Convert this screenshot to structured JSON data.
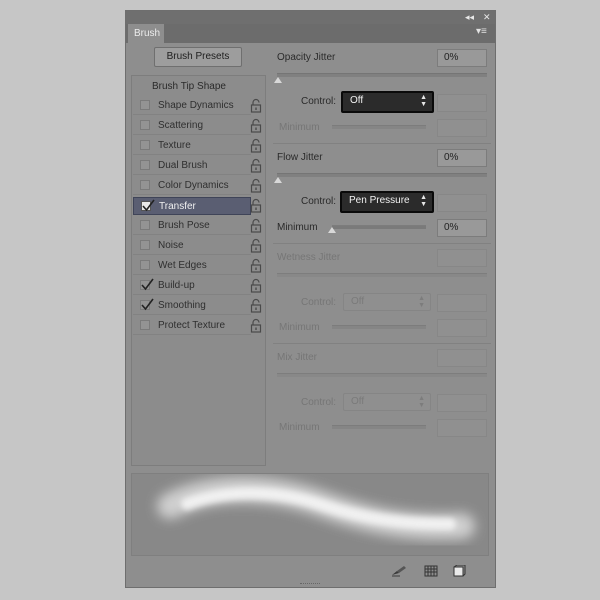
{
  "panel": {
    "title": "Brush",
    "collapse_glyph": "◂◂",
    "close_glyph": "✕",
    "menu_glyph": "▾≡"
  },
  "presets_button": "Brush Presets",
  "sidebar": {
    "header": "Brush Tip Shape",
    "items": [
      {
        "label": "Shape Dynamics",
        "checked": false,
        "selected": false
      },
      {
        "label": "Scattering",
        "checked": false,
        "selected": false
      },
      {
        "label": "Texture",
        "checked": false,
        "selected": false
      },
      {
        "label": "Dual Brush",
        "checked": false,
        "selected": false
      },
      {
        "label": "Color Dynamics",
        "checked": false,
        "selected": false
      },
      {
        "label": "Transfer",
        "checked": true,
        "selected": true
      },
      {
        "label": "Brush Pose",
        "checked": false,
        "selected": false
      },
      {
        "label": "Noise",
        "checked": false,
        "selected": false
      },
      {
        "label": "Wet Edges",
        "checked": false,
        "selected": false
      },
      {
        "label": "Build-up",
        "checked": true,
        "selected": false
      },
      {
        "label": "Smoothing",
        "checked": true,
        "selected": false
      },
      {
        "label": "Protect Texture",
        "checked": false,
        "selected": false
      }
    ]
  },
  "settings": {
    "opacity_jitter": {
      "label": "Opacity Jitter",
      "value": "0%",
      "control_label": "Control:",
      "control_value": "Off",
      "minimum_label": "Minimum"
    },
    "flow_jitter": {
      "label": "Flow Jitter",
      "value": "0%",
      "control_label": "Control:",
      "control_value": "Pen Pressure",
      "minimum_label": "Minimum",
      "minimum_value": "0%"
    },
    "wetness_jitter": {
      "label": "Wetness Jitter",
      "control_label": "Control:",
      "control_value": "Off",
      "minimum_label": "Minimum"
    },
    "mix_jitter": {
      "label": "Mix Jitter",
      "control_label": "Control:",
      "control_value": "Off",
      "minimum_label": "Minimum"
    }
  },
  "footer_icons": [
    "brush-pen-icon",
    "grid-icon",
    "new-brush-icon"
  ],
  "colors": {
    "selected_row": "#5a5e72",
    "dropdown_bg": "#2b2b2b",
    "panel_bg": "#8e8e8e"
  }
}
